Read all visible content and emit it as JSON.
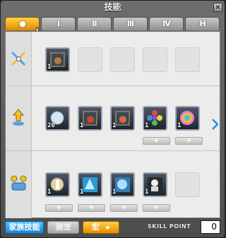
{
  "window": {
    "title": "技能",
    "close_symbol": "×"
  },
  "tabs": [
    {
      "label": "●",
      "active": true
    },
    {
      "label": "I",
      "active": false
    },
    {
      "label": "II",
      "active": false
    },
    {
      "label": "III",
      "active": false
    },
    {
      "label": "IV",
      "active": false
    },
    {
      "label": "H",
      "active": false
    }
  ],
  "rows": [
    {
      "icon": "swords-icon",
      "slots": [
        {
          "filled": true,
          "level": "1"
        },
        {
          "filled": false
        },
        {
          "filled": false
        },
        {
          "filled": false
        },
        {
          "filled": false
        }
      ]
    },
    {
      "icon": "upgrade-arrow-icon",
      "slots": [
        {
          "filled": true,
          "level": "20"
        },
        {
          "filled": true,
          "level": "1"
        },
        {
          "filled": true,
          "level": "1"
        },
        {
          "filled": true,
          "level": "1",
          "plus": "+"
        },
        {
          "filled": true,
          "level": "1",
          "plus": "+"
        }
      ]
    },
    {
      "icon": "family-icon",
      "slots": [
        {
          "filled": true,
          "level": "1",
          "plus": "+"
        },
        {
          "filled": true,
          "level": "1",
          "plus": "+"
        },
        {
          "filled": true,
          "level": "1",
          "plus": "+"
        },
        {
          "filled": true,
          "level": "1",
          "plus": "+"
        },
        {
          "filled": false
        }
      ]
    }
  ],
  "bottom": {
    "family_button": "家族技能",
    "tab2_button": "骑宠",
    "macro_button": "宏",
    "macro_arrow": "▸",
    "skill_point_label": "SKILL POINT",
    "skill_point_value": "0"
  },
  "colors": {
    "active_tab": "#f0a800",
    "family_button": "#2aa0f0",
    "macro_button": "#f5a000"
  }
}
